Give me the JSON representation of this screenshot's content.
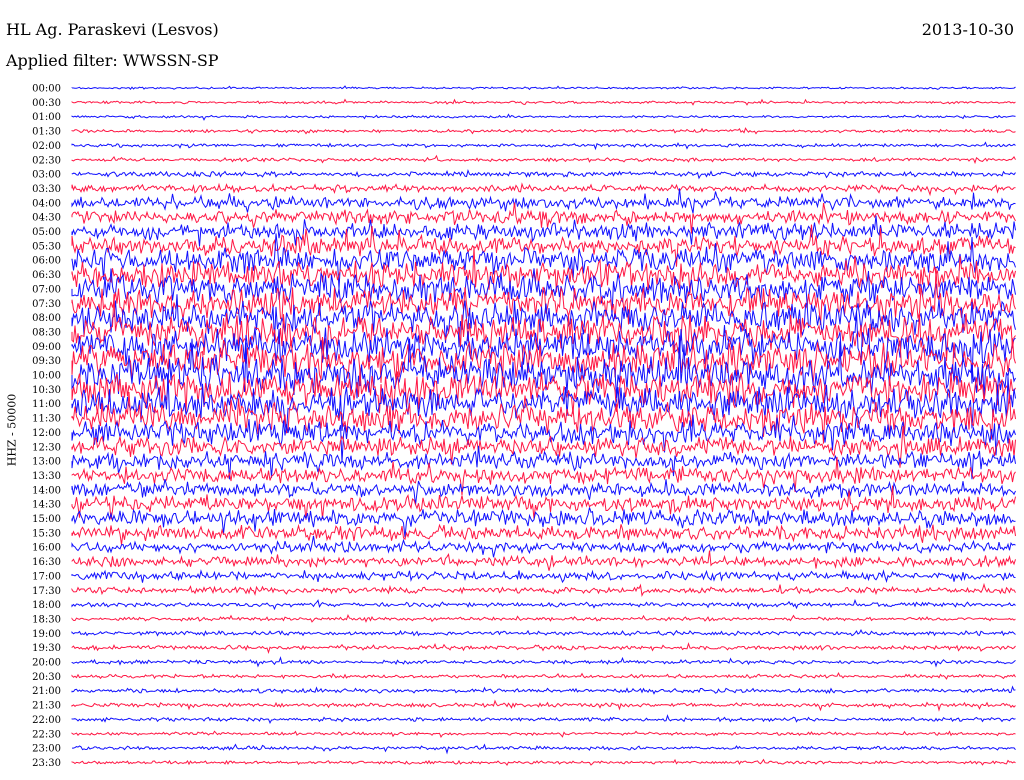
{
  "header": {
    "station": "HL Ag. Paraskevi (Lesvos)",
    "date": "2013-10-30",
    "filter": "Applied filter: WWSSN-SP"
  },
  "chart_data": {
    "type": "line",
    "title": "HL Ag. Paraskevi (Lesvos)",
    "ylabel": "HHZ - 50000",
    "colors": {
      "even_rows": "#1010ff",
      "odd_rows": "#ff1744"
    },
    "rows": [
      {
        "label": "00:00",
        "amp": 0.15
      },
      {
        "label": "00:30",
        "amp": 0.2
      },
      {
        "label": "01:00",
        "amp": 0.2
      },
      {
        "label": "01:30",
        "amp": 0.25
      },
      {
        "label": "02:00",
        "amp": 0.25
      },
      {
        "label": "02:30",
        "amp": 0.3
      },
      {
        "label": "03:00",
        "amp": 0.4
      },
      {
        "label": "03:30",
        "amp": 0.6
      },
      {
        "label": "04:00",
        "amp": 1.0
      },
      {
        "label": "04:30",
        "amp": 1.2
      },
      {
        "label": "05:00",
        "amp": 1.4
      },
      {
        "label": "05:30",
        "amp": 1.6
      },
      {
        "label": "06:00",
        "amp": 2.0
      },
      {
        "label": "06:30",
        "amp": 2.2
      },
      {
        "label": "07:00",
        "amp": 2.4
      },
      {
        "label": "07:30",
        "amp": 2.5
      },
      {
        "label": "08:00",
        "amp": 2.6
      },
      {
        "label": "08:30",
        "amp": 2.8
      },
      {
        "label": "09:00",
        "amp": 3.0
      },
      {
        "label": "09:30",
        "amp": 3.0
      },
      {
        "label": "10:00",
        "amp": 3.0
      },
      {
        "label": "10:30",
        "amp": 2.8
      },
      {
        "label": "11:00",
        "amp": 2.6
      },
      {
        "label": "11:30",
        "amp": 2.4
      },
      {
        "label": "12:00",
        "amp": 2.0
      },
      {
        "label": "12:30",
        "amp": 1.6
      },
      {
        "label": "13:00",
        "amp": 1.4
      },
      {
        "label": "13:30",
        "amp": 1.3
      },
      {
        "label": "14:00",
        "amp": 1.2
      },
      {
        "label": "14:30",
        "amp": 1.3
      },
      {
        "label": "15:00",
        "amp": 1.4
      },
      {
        "label": "15:30",
        "amp": 1.2
      },
      {
        "label": "16:00",
        "amp": 0.9
      },
      {
        "label": "16:30",
        "amp": 0.8
      },
      {
        "label": "17:00",
        "amp": 0.7
      },
      {
        "label": "17:30",
        "amp": 0.5
      },
      {
        "label": "18:00",
        "amp": 0.35
      },
      {
        "label": "18:30",
        "amp": 0.3
      },
      {
        "label": "19:00",
        "amp": 0.35
      },
      {
        "label": "19:30",
        "amp": 0.35
      },
      {
        "label": "20:00",
        "amp": 0.3
      },
      {
        "label": "20:30",
        "amp": 0.3
      },
      {
        "label": "21:00",
        "amp": 0.35
      },
      {
        "label": "21:30",
        "amp": 0.35
      },
      {
        "label": "22:00",
        "amp": 0.3
      },
      {
        "label": "22:30",
        "amp": 0.25
      },
      {
        "label": "23:00",
        "amp": 0.3
      },
      {
        "label": "23:30",
        "amp": 0.25
      }
    ]
  }
}
